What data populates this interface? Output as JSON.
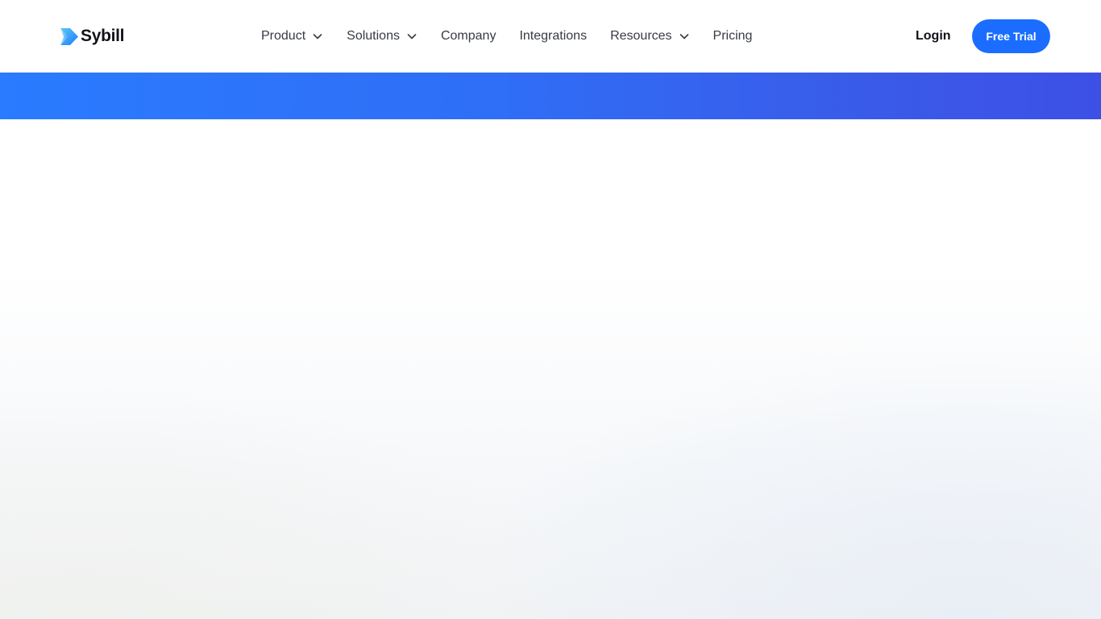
{
  "brand": {
    "name": "Sybill",
    "logo_icon": "sybill-logo-icon",
    "accent_color": "#1a6dff"
  },
  "nav": {
    "items": [
      {
        "label": "Product",
        "has_dropdown": true
      },
      {
        "label": "Solutions",
        "has_dropdown": true
      },
      {
        "label": "Company",
        "has_dropdown": false
      },
      {
        "label": "Integrations",
        "has_dropdown": false
      },
      {
        "label": "Resources",
        "has_dropdown": true
      },
      {
        "label": "Pricing",
        "has_dropdown": false
      }
    ]
  },
  "header_actions": {
    "login_label": "Login",
    "cta_label": "Free Trial"
  },
  "colors": {
    "banner_start": "#2a7bff",
    "banner_end": "#3d50e6",
    "text_primary": "#111318",
    "text_nav": "#373b43"
  }
}
